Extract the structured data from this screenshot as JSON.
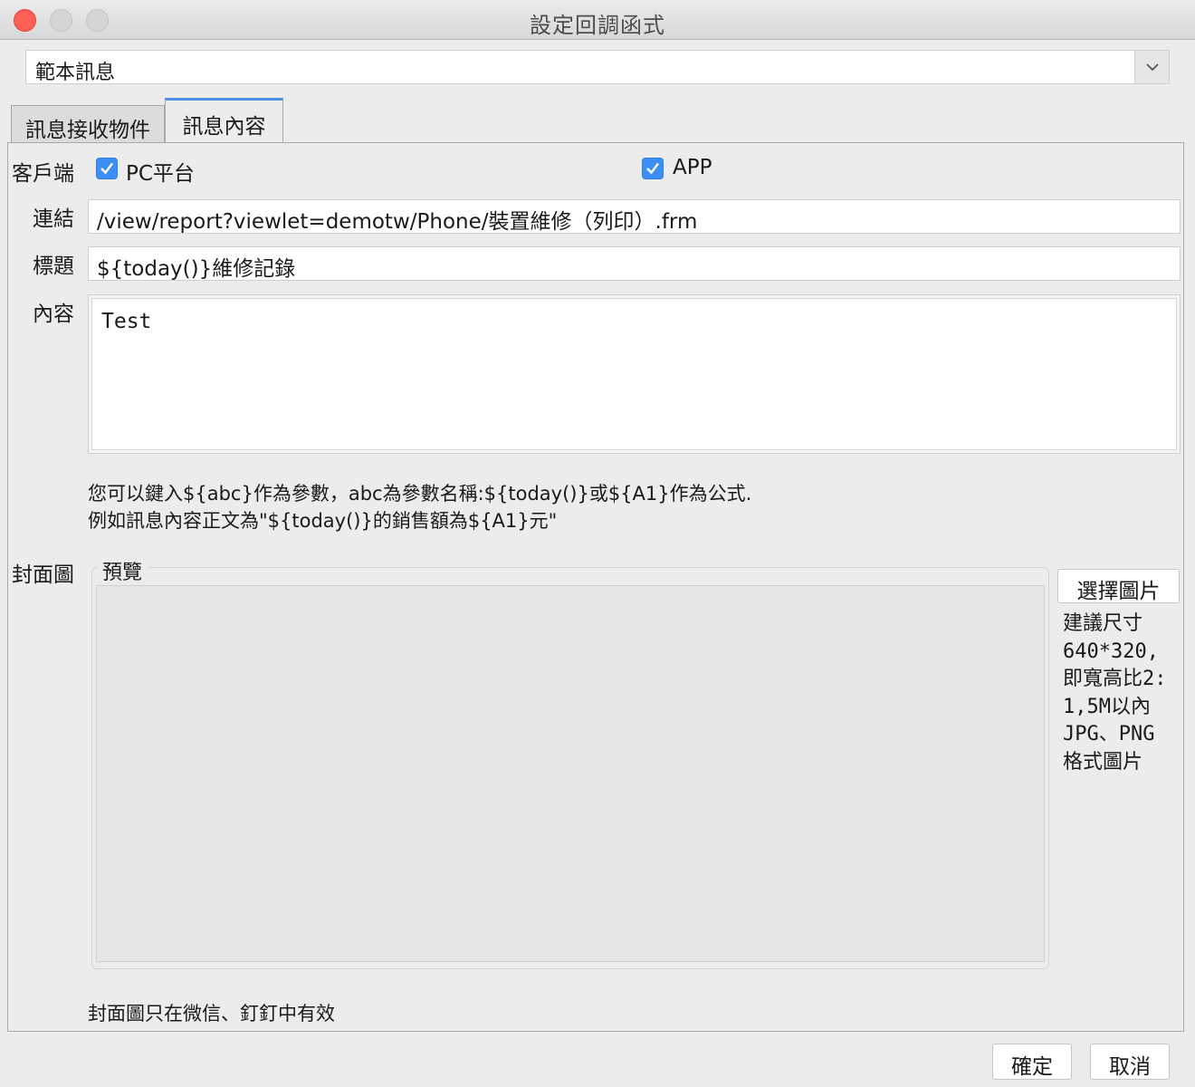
{
  "window": {
    "title": "設定回調函式"
  },
  "template_select": {
    "value": "範本訊息"
  },
  "tabs": [
    {
      "label": "訊息接收物件",
      "active": false
    },
    {
      "label": "訊息內容",
      "active": true
    }
  ],
  "form": {
    "client_label": "客戶端",
    "pc_label": "PC平台",
    "pc_checked": true,
    "app_label": "APP",
    "app_checked": true,
    "link_label": "連結",
    "link_value": "/view/report?viewlet=demotw/Phone/裝置維修（列印）.frm",
    "title_label": "標題",
    "title_value": "${today()}維修記錄",
    "content_label": "內容",
    "content_value": "Test",
    "hint_line1": "您可以鍵入${abc}作為參數，abc為參數名稱:${today()}或${A1}作為公式.",
    "hint_line2": "例如訊息內容正文為\"${today()}的銷售額為${A1}元\"",
    "cover_label": "封面圖",
    "preview_label": "預覽",
    "choose_image_button": "選擇圖片",
    "size_info": [
      "建議尺寸",
      "640*320,",
      "即寬高比2:",
      "1,5M以內",
      "JPG、PNG",
      "格式圖片"
    ],
    "cover_note": "封面圖只在微信、釘釘中有效"
  },
  "footer": {
    "ok_button": "確定",
    "cancel_button": "取消"
  },
  "colors": {
    "accent": "#4a90e2",
    "checkbox": "#3d8ef7",
    "close_button": "#fe5f57"
  }
}
